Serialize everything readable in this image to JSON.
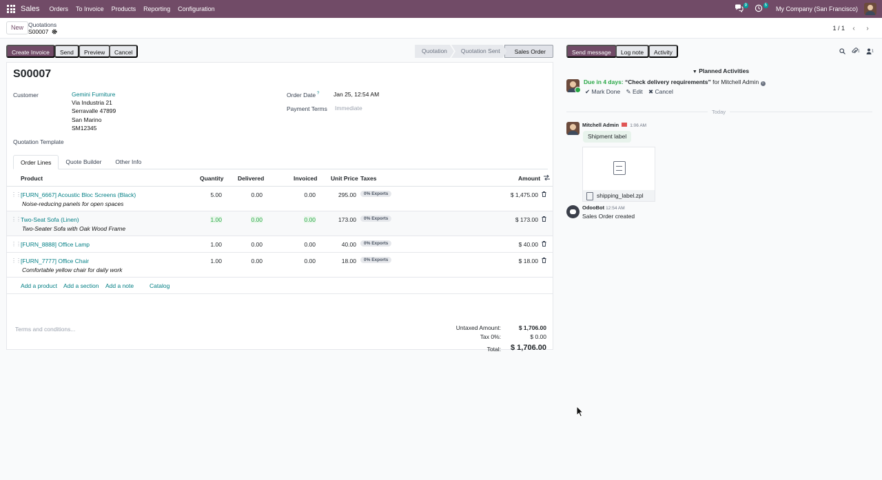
{
  "topbar": {
    "app": "Sales",
    "menu": [
      "Orders",
      "To Invoice",
      "Products",
      "Reporting",
      "Configuration"
    ],
    "messages_count": "9",
    "activities_count": "5",
    "company": "My Company (San Francisco)"
  },
  "control": {
    "new_label": "New",
    "breadcrumb_parent": "Quotations",
    "breadcrumb_current": "S00007",
    "pager": "1 / 1"
  },
  "actions": {
    "create_invoice": "Create Invoice",
    "send": "Send",
    "preview": "Preview",
    "cancel": "Cancel"
  },
  "stages": [
    "Quotation",
    "Quotation Sent",
    "Sales Order"
  ],
  "active_stage": "Sales Order",
  "form": {
    "name": "S00007",
    "customer_label": "Customer",
    "customer_name": "Gemini Furniture",
    "customer_address": [
      "Via Industria 21",
      "Serravalle 47899",
      "San Marino",
      "SM12345"
    ],
    "order_date_label": "Order Date",
    "order_date_help": "?",
    "order_date": "Jan 25, 12:54 AM",
    "payment_terms_label": "Payment Terms",
    "payment_terms_placeholder": "Immediate",
    "quotation_template_label": "Quotation Template"
  },
  "tabs": [
    "Order Lines",
    "Quote Builder",
    "Other Info"
  ],
  "columns": {
    "product": "Product",
    "quantity": "Quantity",
    "delivered": "Delivered",
    "invoiced": "Invoiced",
    "unit_price": "Unit Price",
    "taxes": "Taxes",
    "amount": "Amount"
  },
  "lines": [
    {
      "product": "[FURN_6667] Acoustic Bloc Screens (Black)",
      "note": "Noise-reducing panels for open spaces",
      "quantity": "5.00",
      "delivered": "0.00",
      "invoiced": "0.00",
      "unit_price": "295.00",
      "tax": "0% Exports",
      "amount": "$ 1,475.00"
    },
    {
      "product": "Two-Seat Sofa (Linen)",
      "note": "Two-Seater Sofa with Oak Wood Frame",
      "quantity": "1.00",
      "delivered": "0.00",
      "invoiced": "0.00",
      "unit_price": "173.00",
      "tax": "0% Exports",
      "amount": "$ 173.00"
    },
    {
      "product": "[FURN_8888] Office Lamp",
      "note": "",
      "quantity": "1.00",
      "delivered": "0.00",
      "invoiced": "0.00",
      "unit_price": "40.00",
      "tax": "0% Exports",
      "amount": "$ 40.00"
    },
    {
      "product": "[FURN_7777] Office Chair",
      "note": "Comfortable yellow chair for daily work",
      "quantity": "1.00",
      "delivered": "0.00",
      "invoiced": "0.00",
      "unit_price": "18.00",
      "tax": "0% Exports",
      "amount": "$ 18.00"
    }
  ],
  "add_links": {
    "product": "Add a product",
    "section": "Add a section",
    "note": "Add a note",
    "catalog": "Catalog"
  },
  "terms_placeholder": "Terms and conditions...",
  "totals": {
    "untaxed_label": "Untaxed Amount:",
    "untaxed": "$ 1,706.00",
    "tax_label": "Tax 0%:",
    "tax": "$ 0.00",
    "total_label": "Total:",
    "total": "$ 1,706.00"
  },
  "chatter": {
    "send_message": "Send message",
    "log_note": "Log note",
    "activity": "Activity",
    "attachments_count": "1",
    "followers_count": "1",
    "planned_title": "Planned Activities",
    "activity_due": "Due in 4 days:",
    "activity_summary": "“Check delivery requirements”",
    "activity_for": "for Mitchell Admin",
    "mark_done": "Mark Done",
    "edit": "Edit",
    "cancel": "Cancel",
    "today": "Today",
    "msg1_author": "Mitchell Admin",
    "msg1_time": "1:06 AM",
    "msg1_body": "Shipment label",
    "msg1_attachment": "shipping_label.zpl",
    "msg2_author": "OdooBot",
    "msg2_time": "12:54 AM",
    "msg2_body": "Sales Order created"
  },
  "colors": {
    "brand": "#714b67",
    "link": "#017e84",
    "due": "#28a745"
  }
}
